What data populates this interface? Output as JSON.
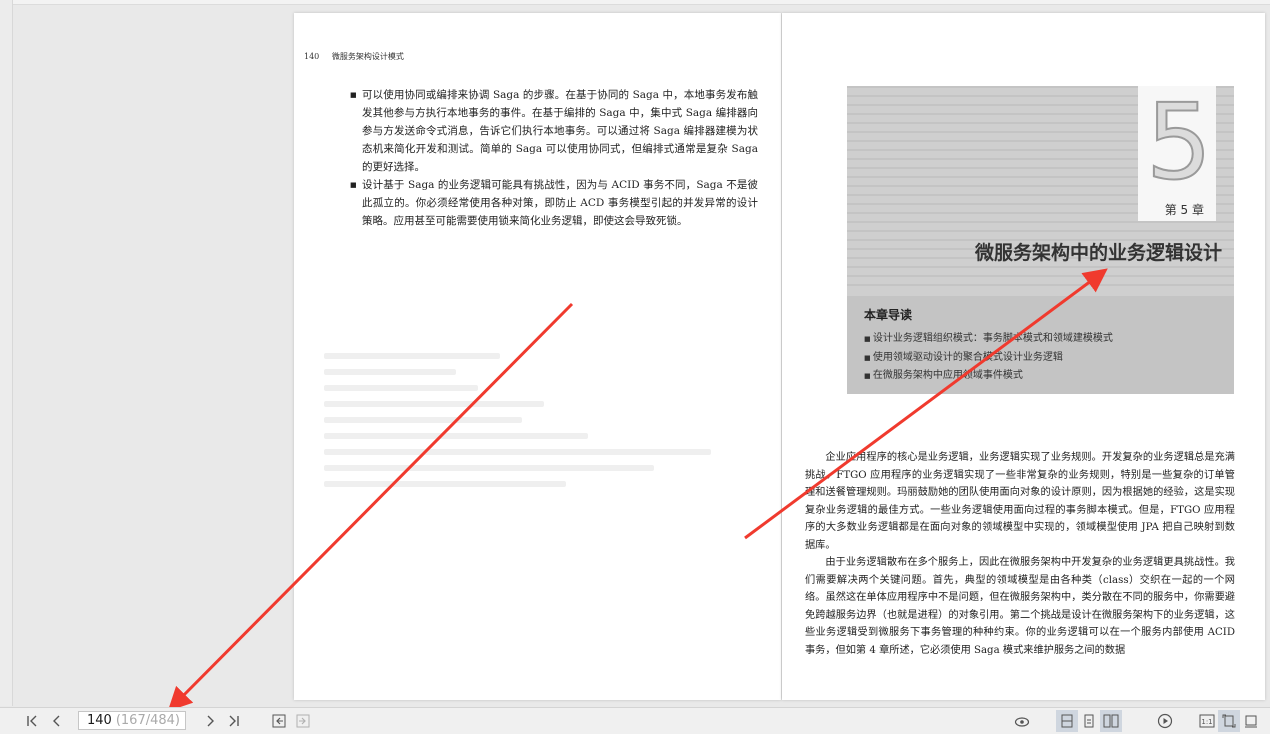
{
  "left_page": {
    "page_number": "140",
    "running_head": "微服务架构设计模式",
    "bullets": [
      "可以使用协同或编排来协调 Saga 的步骤。在基于协同的 Saga 中，本地事务发布触发其他参与方执行本地事务的事件。在基于编排的 Saga 中，集中式 Saga 编排器向参与方发送命令式消息，告诉它们执行本地事务。可以通过将 Saga 编排器建模为状态机来简化开发和测试。简单的 Saga 可以使用协同式，但编排式通常是复杂 Saga 的更好选择。",
      "设计基于 Saga 的业务逻辑可能具有挑战性，因为与 ACID 事务不同，Saga 不是彼此孤立的。你必须经常使用各种对策，即防止 ACD 事务模型引起的并发异常的设计策略。应用甚至可能需要使用锁来简化业务逻辑，即使这会导致死锁。"
    ]
  },
  "right_page": {
    "chapter_number": "5",
    "chapter_label": "第 5 章",
    "chapter_title": "微服务架构中的业务逻辑设计",
    "guide_title": "本章导读",
    "guide_items": [
      "设计业务逻辑组织模式：事务脚本模式和领域建模模式",
      "使用领域驱动设计的聚合模式设计业务逻辑",
      "在微服务架构中应用领域事件模式"
    ],
    "paragraphs": [
      "企业应用程序的核心是业务逻辑，业务逻辑实现了业务规则。开发复杂的业务逻辑总是充满挑战。FTGO 应用程序的业务逻辑实现了一些非常复杂的业务规则，特别是一些复杂的订单管理和送餐管理规则。玛丽鼓励她的团队使用面向对象的设计原则，因为根据她的经验，这是实现复杂业务逻辑的最佳方式。一些业务逻辑使用面向过程的事务脚本模式。但是，FTGO 应用程序的大多数业务逻辑都是在面向对象的领域模型中实现的，领域模型使用 JPA 把自己映射到数据库。",
      "由于业务逻辑散布在多个服务上，因此在微服务架构中开发复杂的业务逻辑更具挑战性。我们需要解决两个关键问题。首先，典型的领域模型是由各种类（class）交织在一起的一个网络。虽然这在单体应用程序中不是问题，但在微服务架构中，类分散在不同的服务中，你需要避免跨越服务边界（也就是进程）的对象引用。第二个挑战是设计在微服务架构下的业务逻辑，这些业务逻辑受到微服务下事务管理的种种约束。你的业务逻辑可以在一个服务内部使用 ACID 事务，但如第 4 章所述，它必须使用 Saga 模式来维护服务之间的数据"
    ]
  },
  "toolbar": {
    "current_page": "140",
    "page_total": "(167/484)"
  },
  "annotation_color": "#f03a2e"
}
